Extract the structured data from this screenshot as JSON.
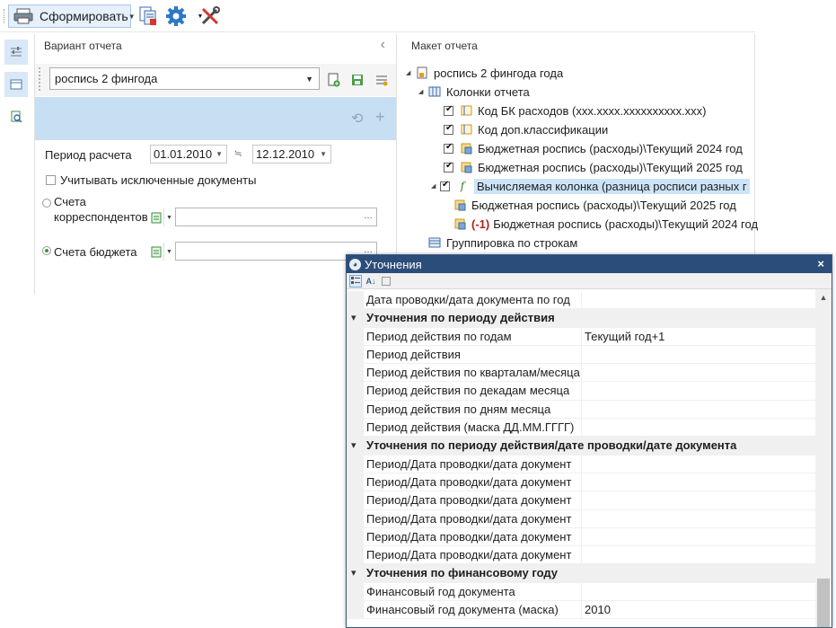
{
  "toolbar": {
    "form_button_label": "Сформировать",
    "icons": [
      "report-form-icon",
      "copy-document-icon",
      "settings-gear-icon",
      "tools-icon"
    ]
  },
  "left_panel": {
    "title": "Вариант отчета",
    "variant_value": "роспись 2 фингода",
    "period_label": "Период расчета",
    "date_from": "01.01.2010",
    "date_to": "12.12.2010",
    "include_excluded_label": "Учитывать исключенные документы",
    "include_excluded_checked": false,
    "radio_correspondent_label": "Счета корреспондентов",
    "radio_budget_label": "Счета бюджета",
    "selected_radio": "budget",
    "correspondent_value": "",
    "budget_value": ""
  },
  "right_panel": {
    "title": "Макет отчета",
    "tree": [
      {
        "label": "роспись 2 фингода года",
        "icon": "report-icon",
        "level": 0,
        "expanded": true
      },
      {
        "label": "Колонки отчета",
        "icon": "columns-icon",
        "level": 1,
        "expanded": true
      },
      {
        "label": "Код БК расходов (xxx.xxxx.xxxxxxxxxx.xxx)",
        "icon": "field-icon",
        "level": 2,
        "checked": true
      },
      {
        "label": "Код доп.классификации",
        "icon": "field-icon",
        "level": 2,
        "checked": true
      },
      {
        "label": "Бюджетная роспись (расходы)\\Текущий 2024 год",
        "icon": "data-icon",
        "level": 2,
        "checked": true
      },
      {
        "label": "Бюджетная роспись (расходы)\\Текущий 2025 год",
        "icon": "data-icon",
        "level": 2,
        "checked": true
      },
      {
        "label": "Вычисляемая колонка (разница росписи разных г",
        "icon": "formula-icon",
        "level": 2,
        "checked": true,
        "selected": true,
        "expanded": true
      },
      {
        "label": "Бюджетная роспись (расходы)\\Текущий 2025 год",
        "icon": "data-icon",
        "level": 3
      },
      {
        "label": "Бюджетная роспись (расходы)\\Текущий 2024 год",
        "prefix": "(-1)",
        "icon": "data-icon",
        "level": 3
      },
      {
        "label": "Группировка по строкам",
        "icon": "rows-icon",
        "level": 1
      }
    ]
  },
  "dialog": {
    "title": "Уточнения",
    "rows": [
      {
        "type": "item",
        "name": "Дата проводки/дата документа по год",
        "value": ""
      },
      {
        "type": "category",
        "name": "Уточнения по периоду действия"
      },
      {
        "type": "item",
        "name": "Период действия по годам",
        "value": "Текущий год+1"
      },
      {
        "type": "item",
        "name": "Период действия",
        "value": ""
      },
      {
        "type": "item",
        "name": "Период действия по кварталам/месяца",
        "value": ""
      },
      {
        "type": "item",
        "name": "Период действия по декадам месяца",
        "value": ""
      },
      {
        "type": "item",
        "name": "Период действия по дням месяца",
        "value": ""
      },
      {
        "type": "item",
        "name": "Период действия (маска ДД.ММ.ГГГГ)",
        "value": ""
      },
      {
        "type": "category",
        "name": "Уточнения по периоду действия/дате проводки/дате документа"
      },
      {
        "type": "item",
        "name": "Период/Дата проводки/дата документ",
        "value": ""
      },
      {
        "type": "item",
        "name": "Период/Дата проводки/дата документ",
        "value": ""
      },
      {
        "type": "item",
        "name": "Период/Дата проводки/дата документ",
        "value": ""
      },
      {
        "type": "item",
        "name": "Период/Дата проводки/дата документ",
        "value": ""
      },
      {
        "type": "item",
        "name": "Период/Дата проводки/дата документ",
        "value": ""
      },
      {
        "type": "item",
        "name": "Период/Дата проводки/дата документ",
        "value": ""
      },
      {
        "type": "category",
        "name": "Уточнения по финансовому году"
      },
      {
        "type": "item",
        "name": "Финансовый год документа",
        "value": ""
      },
      {
        "type": "item",
        "name": "Финансовый год документа (маска)",
        "value": "2010"
      }
    ]
  },
  "colors": {
    "accent_band": "#c6dff3",
    "dialog_title_bg": "#2b4d7a",
    "selection": "#cce4f7",
    "radio_on": "#2f9b2f",
    "negative_prefix": "#b02020"
  }
}
